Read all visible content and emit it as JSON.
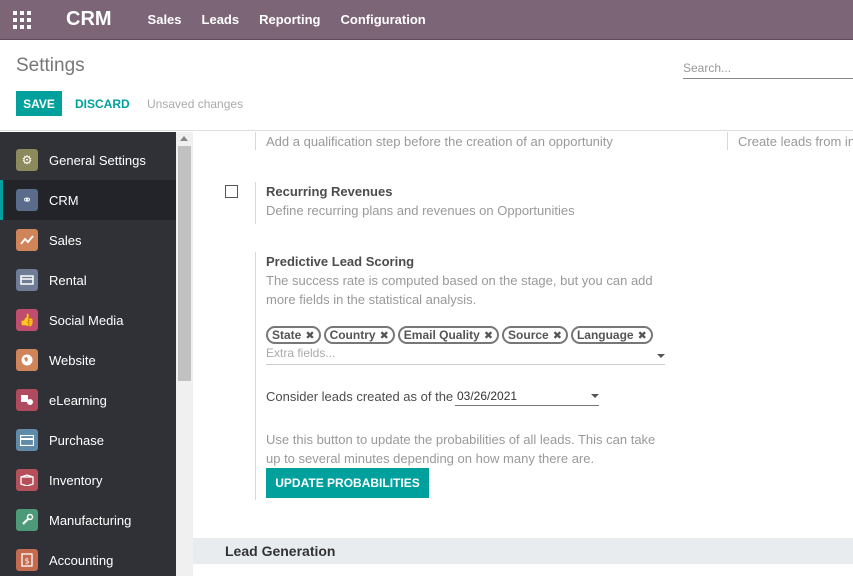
{
  "navbar": {
    "brand": "CRM",
    "menu": [
      "Sales",
      "Leads",
      "Reporting",
      "Configuration"
    ]
  },
  "control_panel": {
    "title": "Settings",
    "search_placeholder": "Search...",
    "save_label": "SAVE",
    "discard_label": "DISCARD",
    "status": "Unsaved changes"
  },
  "sidebar": {
    "items": [
      {
        "label": "General Settings",
        "icon": "gear-icon",
        "color": "#8a8a5c"
      },
      {
        "label": "CRM",
        "icon": "handshake-icon",
        "color": "#5b6b8c"
      },
      {
        "label": "Sales",
        "icon": "chart-icon",
        "color": "#d0845a"
      },
      {
        "label": "Rental",
        "icon": "rental-icon",
        "color": "#6f7c95"
      },
      {
        "label": "Social Media",
        "icon": "thumbs-up-icon",
        "color": "#c04d6e"
      },
      {
        "label": "Website",
        "icon": "globe-icon",
        "color": "#d0845a"
      },
      {
        "label": "eLearning",
        "icon": "elearning-icon",
        "color": "#b04a5e"
      },
      {
        "label": "Purchase",
        "icon": "card-icon",
        "color": "#5f8aa8"
      },
      {
        "label": "Inventory",
        "icon": "box-icon",
        "color": "#b4505a"
      },
      {
        "label": "Manufacturing",
        "icon": "wrench-icon",
        "color": "#4c9a78"
      },
      {
        "label": "Accounting",
        "icon": "document-icon",
        "color": "#c46a4e"
      }
    ],
    "active_index": 1
  },
  "content": {
    "top_desc": "Add a qualification step before the creation of an opportunity",
    "top_right_desc": "Create leads from in",
    "recurring": {
      "title": "Recurring Revenues",
      "desc": "Define recurring plans and revenues on Opportunities",
      "checked": false
    },
    "scoring": {
      "title": "Predictive Lead Scoring",
      "desc_line1": "The success rate is computed based on the stage, but you can add",
      "desc_line2": "more fields in the statistical analysis.",
      "tags": [
        "State",
        "Country",
        "Email Quality",
        "Source",
        "Language"
      ],
      "extra_placeholder": "Extra fields...",
      "consider_label": "Consider leads created as of the",
      "date": "03/26/2021",
      "update_desc_line1": "Use this button to update the probabilities of all leads. This can take",
      "update_desc_line2": "up to several minutes depending on how many there are.",
      "update_button": "UPDATE PROBABILITIES"
    },
    "section_title": "Lead Generation"
  }
}
